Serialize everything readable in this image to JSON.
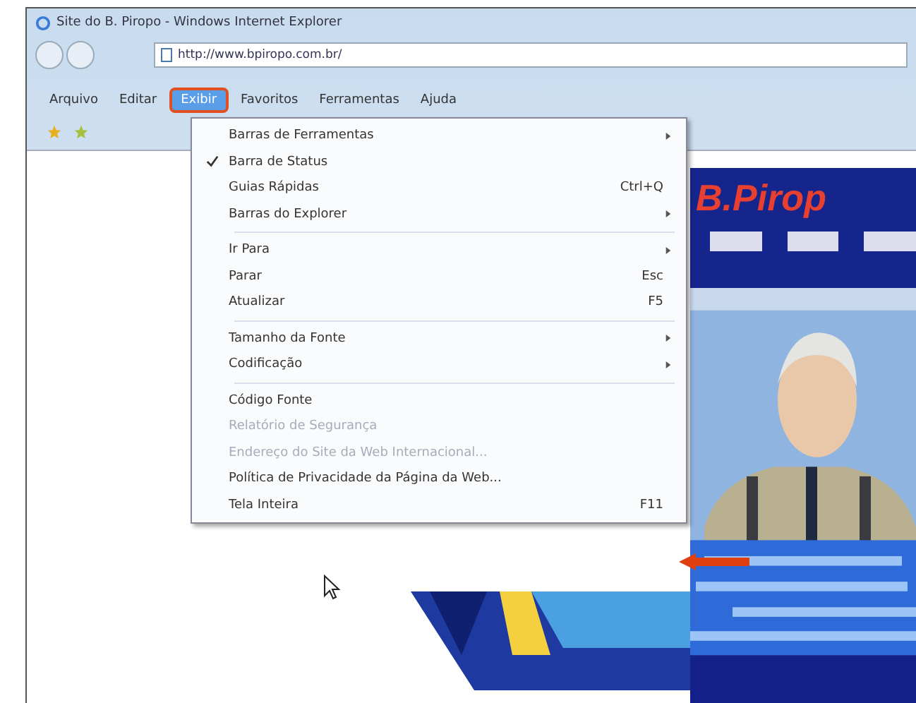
{
  "window": {
    "title": "Site do B. Piropo - Windows Internet Explorer"
  },
  "address_bar": {
    "value": "http://www.bpiropo.com.br/"
  },
  "menu_bar": [
    {
      "label": "Arquivo",
      "selected": false
    },
    {
      "label": "Editar",
      "selected": false
    },
    {
      "label": "Exibir",
      "selected": true
    },
    {
      "label": "Favoritos",
      "selected": false
    },
    {
      "label": "Ferramentas",
      "selected": false
    },
    {
      "label": "Ajuda",
      "selected": false
    }
  ],
  "view_menu": [
    {
      "label": "Barras de Ferramentas",
      "submenu": true,
      "checked": false,
      "disabled": false,
      "separator_after": false
    },
    {
      "label": "Barra de Status",
      "submenu": false,
      "checked": true,
      "disabled": false,
      "separator_after": false
    },
    {
      "label": "Guias Rápidas",
      "shortcut": "Ctrl+Q",
      "submenu": false,
      "checked": false,
      "disabled": false,
      "separator_after": false
    },
    {
      "label": "Barras do Explorer",
      "submenu": true,
      "checked": false,
      "disabled": false,
      "separator_after": true
    },
    {
      "label": "Ir Para",
      "submenu": true,
      "checked": false,
      "disabled": false,
      "separator_after": false
    },
    {
      "label": "Parar",
      "shortcut": "Esc",
      "submenu": false,
      "checked": false,
      "disabled": false,
      "separator_after": false
    },
    {
      "label": "Atualizar",
      "shortcut": "F5",
      "submenu": false,
      "checked": false,
      "disabled": false,
      "separator_after": true
    },
    {
      "label": "Tamanho da Fonte",
      "submenu": true,
      "checked": false,
      "disabled": false,
      "separator_after": false
    },
    {
      "label": "Codificação",
      "submenu": true,
      "checked": false,
      "disabled": false,
      "separator_after": true
    },
    {
      "label": "Código Fonte",
      "submenu": false,
      "checked": false,
      "disabled": false,
      "separator_after": false
    },
    {
      "label": "Relatório de Segurança",
      "submenu": false,
      "checked": false,
      "disabled": true,
      "separator_after": false
    },
    {
      "label": "Endereço do Site da Web Internacional...",
      "submenu": false,
      "checked": false,
      "disabled": true,
      "separator_after": false
    },
    {
      "label": "Política de Privacidade da Página da Web...",
      "submenu": false,
      "checked": false,
      "disabled": false,
      "separator_after": false
    },
    {
      "label": "Tela Inteira",
      "shortcut": "F11",
      "submenu": false,
      "checked": false,
      "disabled": false,
      "separator_after": false
    }
  ],
  "web_page": {
    "logo": "B.Pirop"
  }
}
